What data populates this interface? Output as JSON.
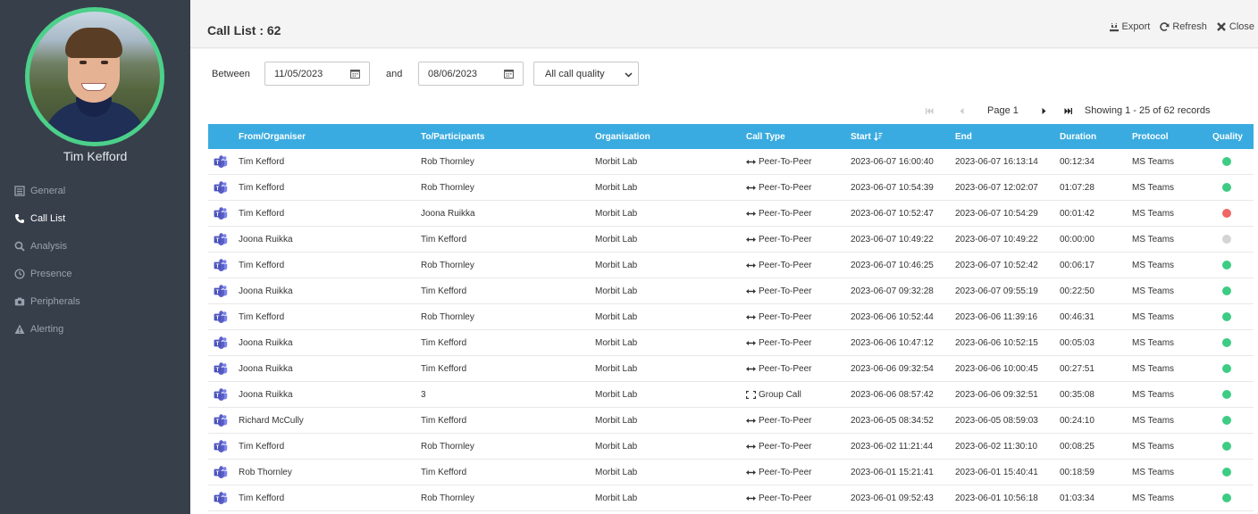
{
  "sidebar": {
    "user_name": "Tim Kefford",
    "items": [
      {
        "label": "General",
        "icon": "list-icon",
        "active": false
      },
      {
        "label": "Call List",
        "icon": "phone-icon",
        "active": true
      },
      {
        "label": "Analysis",
        "icon": "search-icon",
        "active": false
      },
      {
        "label": "Presence",
        "icon": "clock-icon",
        "active": false
      },
      {
        "label": "Peripherals",
        "icon": "camera-icon",
        "active": false
      },
      {
        "label": "Alerting",
        "icon": "warning-icon",
        "active": false
      }
    ]
  },
  "header": {
    "title": "Call List : 62",
    "export_label": "Export",
    "refresh_label": "Refresh",
    "close_label": "Close"
  },
  "filters": {
    "between_label": "Between",
    "and_label": "and",
    "from_date": "11/05/2023",
    "to_date": "08/06/2023",
    "quality_selected": "All call quality"
  },
  "pager": {
    "page_label": "Page 1",
    "showing_label": "Showing 1 - 25 of 62 records"
  },
  "table": {
    "columns": [
      "From/Organiser",
      "To/Participants",
      "Organisation",
      "Call Type",
      "Start",
      "End",
      "Duration",
      "Protocol",
      "Quality"
    ],
    "rows": [
      {
        "from": "Tim Kefford",
        "to": "Rob Thornley",
        "org": "Morbit Lab",
        "type": "Peer-To-Peer",
        "start": "2023-06-07 16:00:40",
        "end": "2023-06-07 16:13:14",
        "duration": "00:12:34",
        "protocol": "MS Teams",
        "quality": "good"
      },
      {
        "from": "Tim Kefford",
        "to": "Rob Thornley",
        "org": "Morbit Lab",
        "type": "Peer-To-Peer",
        "start": "2023-06-07 10:54:39",
        "end": "2023-06-07 12:02:07",
        "duration": "01:07:28",
        "protocol": "MS Teams",
        "quality": "good"
      },
      {
        "from": "Tim Kefford",
        "to": "Joona Ruikka",
        "org": "Morbit Lab",
        "type": "Peer-To-Peer",
        "start": "2023-06-07 10:52:47",
        "end": "2023-06-07 10:54:29",
        "duration": "00:01:42",
        "protocol": "MS Teams",
        "quality": "poor"
      },
      {
        "from": "Joona Ruikka",
        "to": "Tim Kefford",
        "org": "Morbit Lab",
        "type": "Peer-To-Peer",
        "start": "2023-06-07 10:49:22",
        "end": "2023-06-07 10:49:22",
        "duration": "00:00:00",
        "protocol": "MS Teams",
        "quality": "unknown"
      },
      {
        "from": "Tim Kefford",
        "to": "Rob Thornley",
        "org": "Morbit Lab",
        "type": "Peer-To-Peer",
        "start": "2023-06-07 10:46:25",
        "end": "2023-06-07 10:52:42",
        "duration": "00:06:17",
        "protocol": "MS Teams",
        "quality": "good"
      },
      {
        "from": "Joona Ruikka",
        "to": "Tim Kefford",
        "org": "Morbit Lab",
        "type": "Peer-To-Peer",
        "start": "2023-06-07 09:32:28",
        "end": "2023-06-07 09:55:19",
        "duration": "00:22:50",
        "protocol": "MS Teams",
        "quality": "good"
      },
      {
        "from": "Tim Kefford",
        "to": "Rob Thornley",
        "org": "Morbit Lab",
        "type": "Peer-To-Peer",
        "start": "2023-06-06 10:52:44",
        "end": "2023-06-06 11:39:16",
        "duration": "00:46:31",
        "protocol": "MS Teams",
        "quality": "good"
      },
      {
        "from": "Joona Ruikka",
        "to": "Tim Kefford",
        "org": "Morbit Lab",
        "type": "Peer-To-Peer",
        "start": "2023-06-06 10:47:12",
        "end": "2023-06-06 10:52:15",
        "duration": "00:05:03",
        "protocol": "MS Teams",
        "quality": "good"
      },
      {
        "from": "Joona Ruikka",
        "to": "Tim Kefford",
        "org": "Morbit Lab",
        "type": "Peer-To-Peer",
        "start": "2023-06-06 09:32:54",
        "end": "2023-06-06 10:00:45",
        "duration": "00:27:51",
        "protocol": "MS Teams",
        "quality": "good"
      },
      {
        "from": "Joona Ruikka",
        "to": "3",
        "org": "Morbit Lab",
        "type": "Group Call",
        "start": "2023-06-06 08:57:42",
        "end": "2023-06-06 09:32:51",
        "duration": "00:35:08",
        "protocol": "MS Teams",
        "quality": "good"
      },
      {
        "from": "Richard McCully",
        "to": "Tim Kefford",
        "org": "Morbit Lab",
        "type": "Peer-To-Peer",
        "start": "2023-06-05 08:34:52",
        "end": "2023-06-05 08:59:03",
        "duration": "00:24:10",
        "protocol": "MS Teams",
        "quality": "good"
      },
      {
        "from": "Tim Kefford",
        "to": "Rob Thornley",
        "org": "Morbit Lab",
        "type": "Peer-To-Peer",
        "start": "2023-06-02 11:21:44",
        "end": "2023-06-02 11:30:10",
        "duration": "00:08:25",
        "protocol": "MS Teams",
        "quality": "good"
      },
      {
        "from": "Rob Thornley",
        "to": "Tim Kefford",
        "org": "Morbit Lab",
        "type": "Peer-To-Peer",
        "start": "2023-06-01 15:21:41",
        "end": "2023-06-01 15:40:41",
        "duration": "00:18:59",
        "protocol": "MS Teams",
        "quality": "good"
      },
      {
        "from": "Tim Kefford",
        "to": "Rob Thornley",
        "org": "Morbit Lab",
        "type": "Peer-To-Peer",
        "start": "2023-06-01 09:52:43",
        "end": "2023-06-01 10:56:18",
        "duration": "01:03:34",
        "protocol": "MS Teams",
        "quality": "good"
      }
    ]
  },
  "colors": {
    "sidebar_bg": "#373f4b",
    "avatar_ring": "#4cd08a",
    "table_header": "#3aabe0",
    "quality_good": "#3dcc84",
    "quality_poor": "#ee6666",
    "quality_unknown": "#d4d4d4",
    "teams_purple": "#5b5fc7"
  }
}
